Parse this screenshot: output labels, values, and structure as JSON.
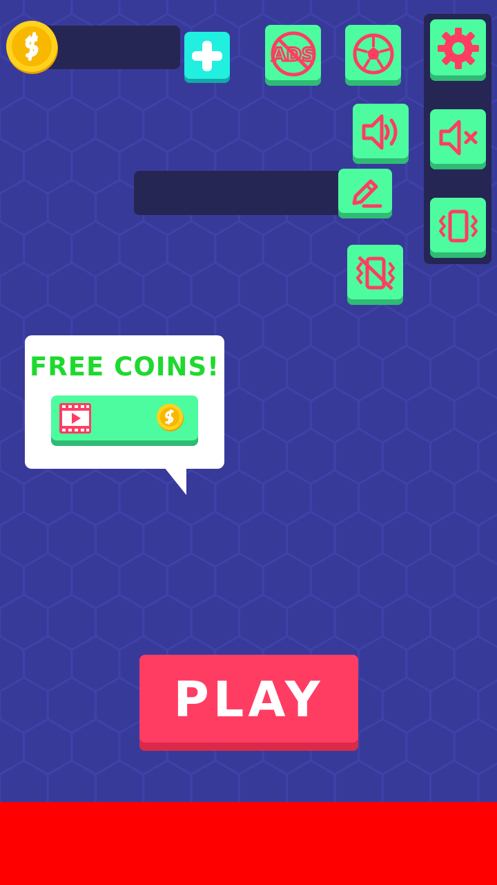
{
  "colors": {
    "background": "#383a9a",
    "panel_dark": "#262654",
    "button_green": "#4dfc9f",
    "button_cyan": "#21efe0",
    "icon_pink": "#ff3d63",
    "free_coins_text": "#1ed92e",
    "play_button": "#ff3d63",
    "ad_banner": "#ff0000"
  },
  "top_bar": {
    "coin_icon": "coin-icon",
    "coin_count": "",
    "add_coins_icon": "plus-icon",
    "remove_ads_icon": "no-ads-icon",
    "ball_shop_icon": "soccer-ball-icon"
  },
  "player": {
    "name": "",
    "edit_icon": "pencil-icon"
  },
  "settings_panel": {
    "toggle_icon": "gear-icon",
    "items": [
      {
        "icon": "speaker-on-icon",
        "state": "sound on"
      },
      {
        "icon": "speaker-muted-icon",
        "state": "sound off"
      },
      {
        "icon": "vibrate-icon",
        "state": "vibration on"
      },
      {
        "icon": "vibrate-off-icon",
        "state": "vibration off"
      }
    ]
  },
  "free_coins": {
    "title": "FREE COINS!",
    "video_icon": "video-icon",
    "coin_icon": "coin-icon"
  },
  "play": {
    "label": "PLAY"
  }
}
